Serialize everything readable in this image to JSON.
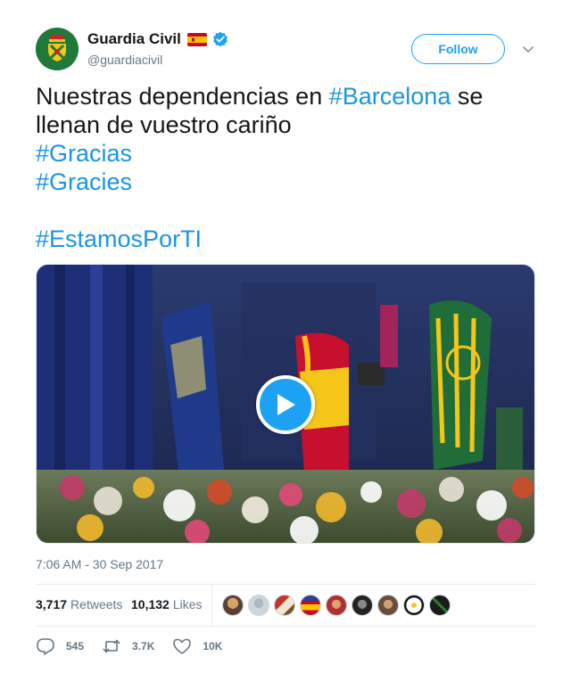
{
  "account": {
    "display_name": "Guardia Civil",
    "handle": "@guardiacivil",
    "verified": true,
    "follow_label": "Follow"
  },
  "tweet": {
    "line1_text": "Nuestras dependencias en ",
    "line1_hashtag": "#Barcelona",
    "line1_tail": " se",
    "line2_text": "llenan de vuestro cariño",
    "hashtag1": "#Gracias",
    "hashtag2": "#Gracies",
    "hashtag3": "#EstamosPorTI",
    "timestamp": "7:06 AM - 30 Sep 2017"
  },
  "stats": {
    "retweets_count": "3,717",
    "retweets_label": "Retweets",
    "likes_count": "10,132",
    "likes_label": "Likes",
    "liker_avatars": 9
  },
  "actions": {
    "replies": "545",
    "retweets": "3.7K",
    "likes": "10K"
  },
  "colors": {
    "accent": "#1da1f2",
    "hashtag": "#1b95e0",
    "muted": "#657786",
    "avatar_bg": "#1f7a3a"
  },
  "icons": [
    "guardia-civil-logo-icon",
    "spain-flag-icon",
    "verified-badge-icon",
    "chevron-down-icon",
    "play-icon",
    "reply-icon",
    "retweet-icon",
    "heart-icon"
  ]
}
